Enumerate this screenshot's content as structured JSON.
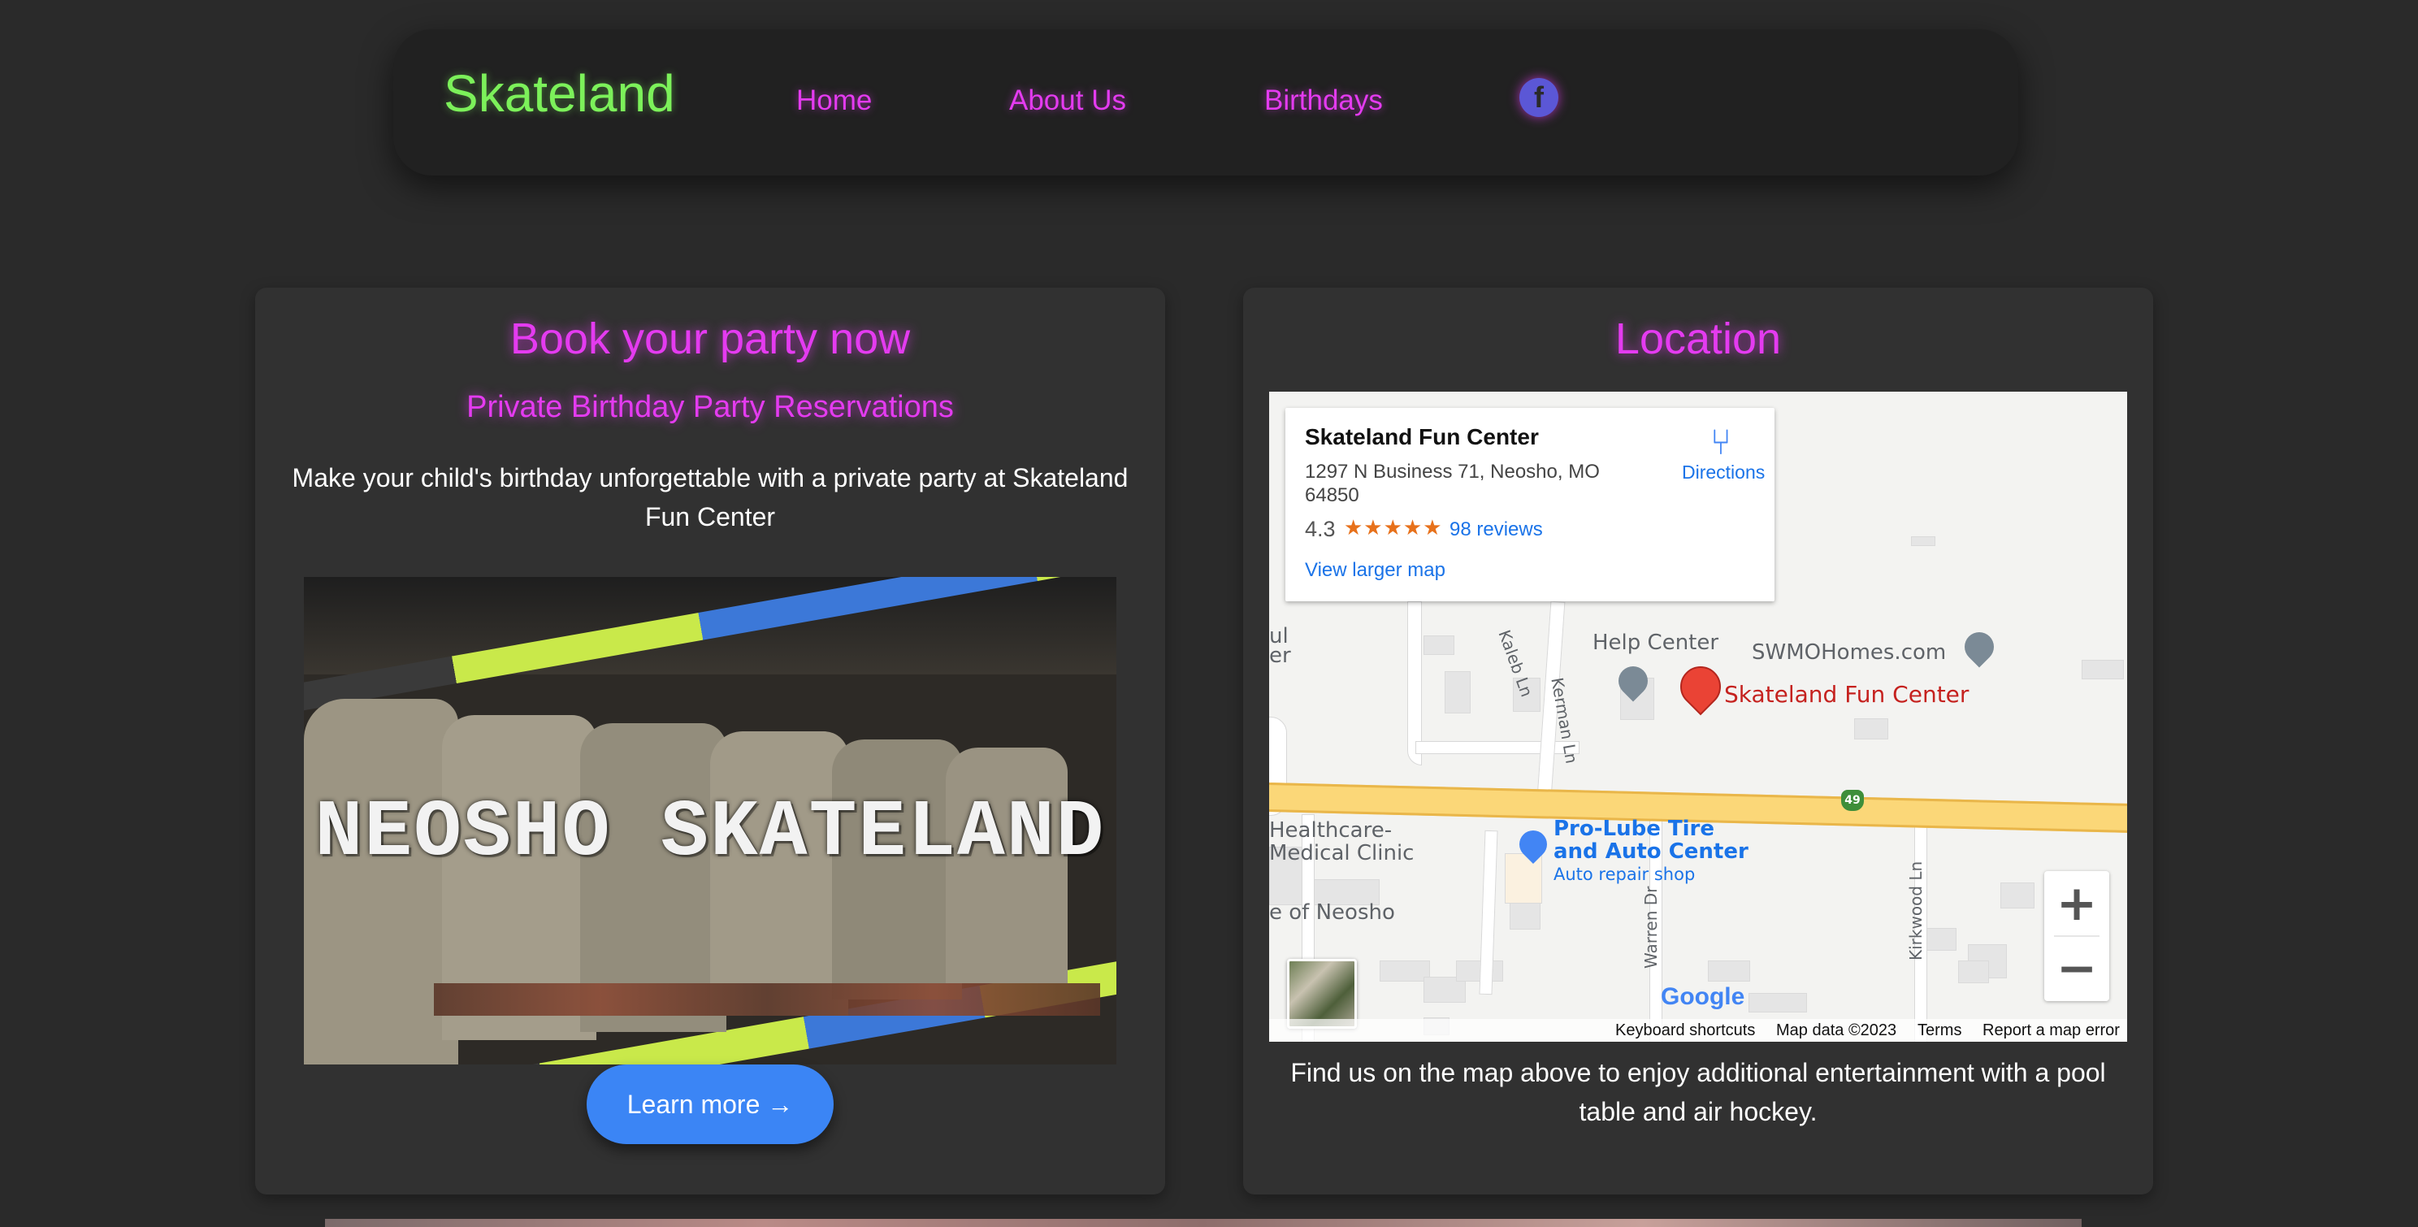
{
  "nav": {
    "brand": "Skateland",
    "links": [
      "Home",
      "About Us",
      "Birthdays"
    ],
    "facebook_icon": "facebook-icon"
  },
  "party": {
    "title": "Book your party now",
    "subtitle": "Private Birthday Party Reservations",
    "description": "Make your child's birthday unforgettable with a private party at Skateland Fun Center",
    "image_text": "NEOSHO SKATELAND",
    "button": "Learn more →"
  },
  "location": {
    "title": "Location",
    "description": "Find us on the map above to enjoy additional entertainment with a pool table and air hockey.",
    "map": {
      "place_name": "Skateland Fun Center",
      "address": "1297 N Business 71, Neosho, MO 64850",
      "rating": "4.3",
      "stars": "★★★★★",
      "star_fraction": 0.86,
      "reviews": "98 reviews",
      "directions": "Directions",
      "view_larger": "View larger map",
      "labels": {
        "help_center": "Help Center",
        "swmo": "SWMOHomes.com",
        "pin": "Skateland Fun Center",
        "prolube": "Pro-Lube Tire and Auto Center",
        "prolube_sub": "Auto repair shop",
        "clinic": "Healthcare-Medical Clinic",
        "neosho": "e of Neosho",
        "edge1": "ul",
        "edge2": "er",
        "kaleb": "Kaleb Ln",
        "kerman": "Kerman Ln",
        "warren": "Warren Dr",
        "kirkwood": "Kirkwood Ln",
        "highway": "49",
        "google": "Google"
      },
      "attribution": {
        "shortcuts": "Keyboard shortcuts",
        "data": "Map data ©2023",
        "terms": "Terms",
        "report": "Report a map error"
      },
      "zoom_in": "+",
      "zoom_out": "−"
    }
  },
  "colors": {
    "background": "#2a2a2a",
    "brand_green": "#7cf15a",
    "neon_pink": "#e43bf0",
    "button_blue": "#3b85f5",
    "map_link_blue": "#1a73e8",
    "pin_red": "#ea4335"
  }
}
